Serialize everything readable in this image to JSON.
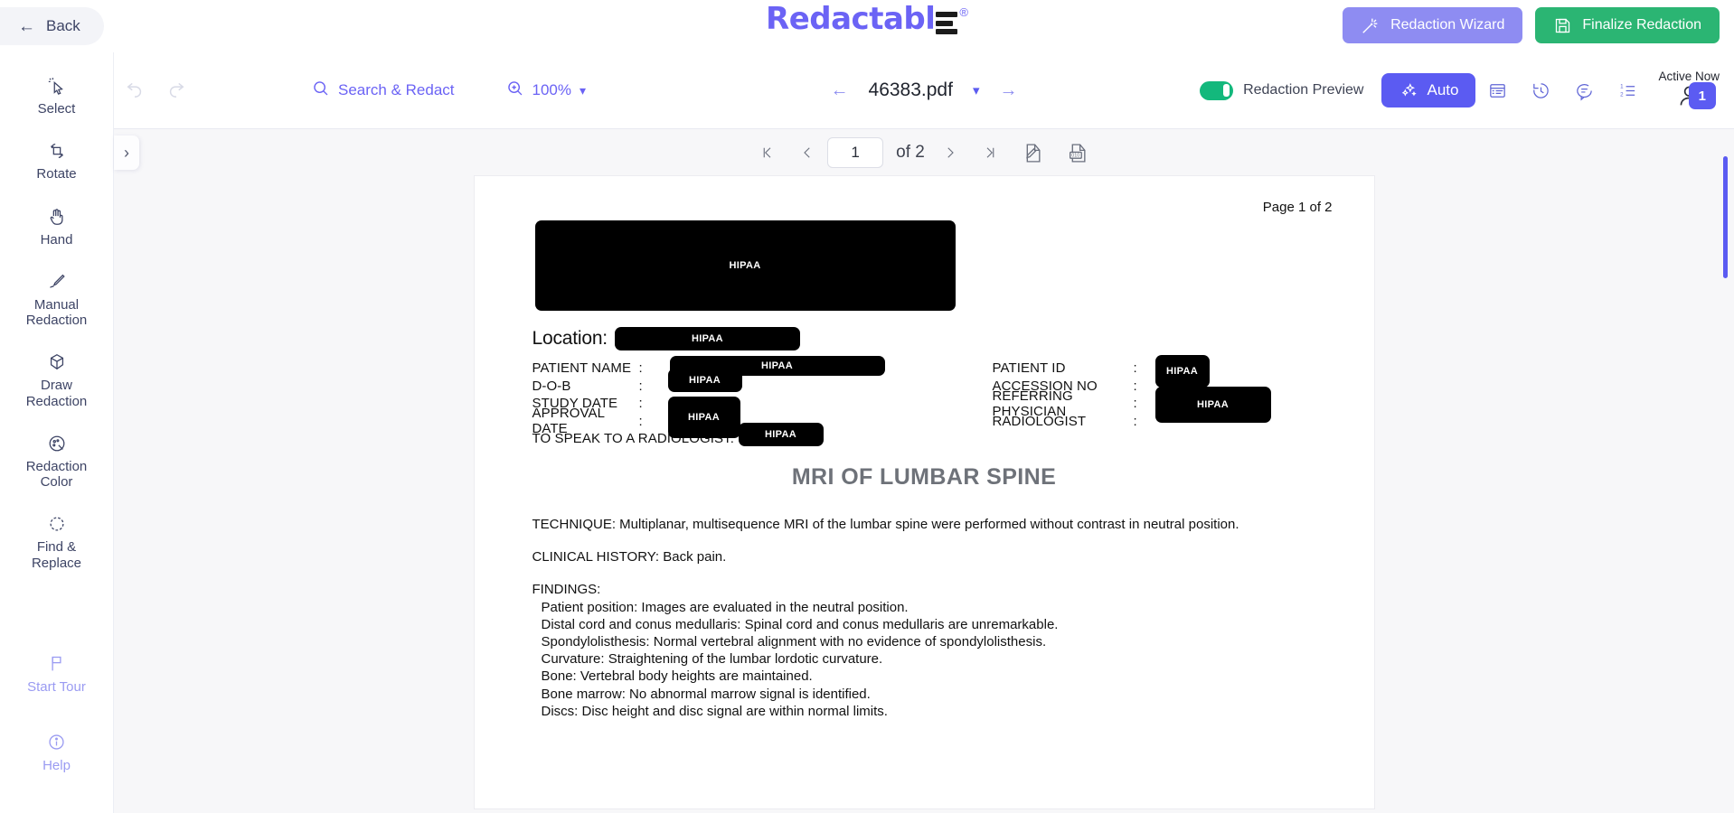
{
  "header": {
    "back_label": "Back",
    "logo_text": "Redactabl",
    "logo_reg": "®",
    "wizard_label": "Redaction Wizard",
    "finalize_label": "Finalize Redaction"
  },
  "rail": {
    "items": [
      {
        "label": "Select",
        "icon": "cursor-select-icon"
      },
      {
        "label": "Rotate",
        "icon": "rotate-icon"
      },
      {
        "label": "Hand",
        "icon": "hand-icon"
      },
      {
        "label": "Manual\nRedaction",
        "label_line1": "Manual",
        "label_line2": "Redaction",
        "icon": "pen-icon"
      },
      {
        "label": "Draw\nRedaction",
        "label_line1": "Draw",
        "label_line2": "Redaction",
        "icon": "cube-icon"
      },
      {
        "label": "Redaction\nColor",
        "label_line1": "Redaction",
        "label_line2": "Color",
        "icon": "palette-icon"
      },
      {
        "label": "Find &\nReplace",
        "label_line1": "Find &",
        "label_line2": "Replace",
        "icon": "refresh-icon"
      }
    ],
    "footer_items": [
      {
        "label": "Start Tour",
        "icon": "flag-icon"
      },
      {
        "label": "Help",
        "icon": "info-icon"
      }
    ]
  },
  "toolbar": {
    "search_label": "Search & Redact",
    "zoom_level": "100%",
    "file_name": "46383.pdf",
    "preview_toggle_label": "Redaction Preview",
    "auto_label": "Auto",
    "active_now_label": "Active Now",
    "active_now_count": "1",
    "icons": [
      "panel-icon",
      "history-icon",
      "comment-icon",
      "numbered-list-icon"
    ]
  },
  "pager": {
    "current_page": "1",
    "of_label": "of 2",
    "first_label": "|<",
    "prev_label": "‹",
    "next_label": "›",
    "last_label": ">|"
  },
  "document": {
    "page_label": "Page 1 of 2",
    "redaction_tag": "HIPAA",
    "location_label": "Location:",
    "fields_left": [
      {
        "name": "PATIENT NAME",
        "colon": ":"
      },
      {
        "name": "D-O-B",
        "colon": ":"
      },
      {
        "name": "STUDY DATE",
        "colon": ":"
      },
      {
        "name": "APPROVAL DATE",
        "colon": ":"
      },
      {
        "name": "TO SPEAK TO A RADIOLOGIST:",
        "colon": ""
      }
    ],
    "fields_right": [
      {
        "name": "PATIENT ID",
        "colon": ":"
      },
      {
        "name": "ACCESSION NO",
        "colon": ":"
      },
      {
        "name": "REFERRING PHYSICIAN",
        "colon": ":"
      },
      {
        "name": "RADIOLOGIST",
        "colon": ":"
      }
    ],
    "title": "MRI OF LUMBAR SPINE",
    "technique": "TECHNIQUE: Multiplanar, multisequence MRI of the lumbar spine were performed without contrast in neutral position.",
    "clinical_history": "CLINICAL HISTORY: Back pain.",
    "findings_heading": "FINDINGS:",
    "findings": [
      "Patient position: Images are evaluated in the neutral position.",
      "Distal cord and conus medullaris: Spinal cord and conus medullaris are unremarkable.",
      "Spondylolisthesis: Normal vertebral alignment with no evidence of spondylolisthesis.",
      "Curvature: Straightening of the lumbar lordotic curvature.",
      "Bone: Vertebral body heights are maintained.",
      "Bone marrow: No abnormal marrow signal is identified.",
      "Discs: Disc height and disc signal are within normal limits."
    ]
  },
  "colors": {
    "brand_purple": "#6b63f5",
    "accent_purple": "#5b5bf2",
    "wizard_purple": "#8e8cf2",
    "finalize_green": "#2bb573",
    "toggle_green": "#13b87c",
    "redaction_black": "#000000"
  }
}
